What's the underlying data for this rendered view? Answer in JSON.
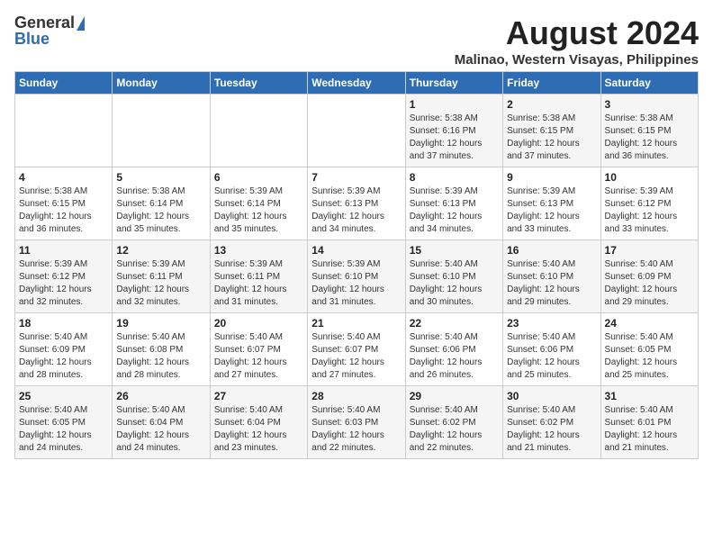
{
  "logo": {
    "general": "General",
    "blue": "Blue"
  },
  "title": "August 2024",
  "location": "Malinao, Western Visayas, Philippines",
  "days_of_week": [
    "Sunday",
    "Monday",
    "Tuesday",
    "Wednesday",
    "Thursday",
    "Friday",
    "Saturday"
  ],
  "weeks": [
    [
      {
        "day": "",
        "info": ""
      },
      {
        "day": "",
        "info": ""
      },
      {
        "day": "",
        "info": ""
      },
      {
        "day": "",
        "info": ""
      },
      {
        "day": "1",
        "info": "Sunrise: 5:38 AM\nSunset: 6:16 PM\nDaylight: 12 hours\nand 37 minutes."
      },
      {
        "day": "2",
        "info": "Sunrise: 5:38 AM\nSunset: 6:15 PM\nDaylight: 12 hours\nand 37 minutes."
      },
      {
        "day": "3",
        "info": "Sunrise: 5:38 AM\nSunset: 6:15 PM\nDaylight: 12 hours\nand 36 minutes."
      }
    ],
    [
      {
        "day": "4",
        "info": "Sunrise: 5:38 AM\nSunset: 6:15 PM\nDaylight: 12 hours\nand 36 minutes."
      },
      {
        "day": "5",
        "info": "Sunrise: 5:38 AM\nSunset: 6:14 PM\nDaylight: 12 hours\nand 35 minutes."
      },
      {
        "day": "6",
        "info": "Sunrise: 5:39 AM\nSunset: 6:14 PM\nDaylight: 12 hours\nand 35 minutes."
      },
      {
        "day": "7",
        "info": "Sunrise: 5:39 AM\nSunset: 6:13 PM\nDaylight: 12 hours\nand 34 minutes."
      },
      {
        "day": "8",
        "info": "Sunrise: 5:39 AM\nSunset: 6:13 PM\nDaylight: 12 hours\nand 34 minutes."
      },
      {
        "day": "9",
        "info": "Sunrise: 5:39 AM\nSunset: 6:13 PM\nDaylight: 12 hours\nand 33 minutes."
      },
      {
        "day": "10",
        "info": "Sunrise: 5:39 AM\nSunset: 6:12 PM\nDaylight: 12 hours\nand 33 minutes."
      }
    ],
    [
      {
        "day": "11",
        "info": "Sunrise: 5:39 AM\nSunset: 6:12 PM\nDaylight: 12 hours\nand 32 minutes."
      },
      {
        "day": "12",
        "info": "Sunrise: 5:39 AM\nSunset: 6:11 PM\nDaylight: 12 hours\nand 32 minutes."
      },
      {
        "day": "13",
        "info": "Sunrise: 5:39 AM\nSunset: 6:11 PM\nDaylight: 12 hours\nand 31 minutes."
      },
      {
        "day": "14",
        "info": "Sunrise: 5:39 AM\nSunset: 6:10 PM\nDaylight: 12 hours\nand 31 minutes."
      },
      {
        "day": "15",
        "info": "Sunrise: 5:40 AM\nSunset: 6:10 PM\nDaylight: 12 hours\nand 30 minutes."
      },
      {
        "day": "16",
        "info": "Sunrise: 5:40 AM\nSunset: 6:10 PM\nDaylight: 12 hours\nand 29 minutes."
      },
      {
        "day": "17",
        "info": "Sunrise: 5:40 AM\nSunset: 6:09 PM\nDaylight: 12 hours\nand 29 minutes."
      }
    ],
    [
      {
        "day": "18",
        "info": "Sunrise: 5:40 AM\nSunset: 6:09 PM\nDaylight: 12 hours\nand 28 minutes."
      },
      {
        "day": "19",
        "info": "Sunrise: 5:40 AM\nSunset: 6:08 PM\nDaylight: 12 hours\nand 28 minutes."
      },
      {
        "day": "20",
        "info": "Sunrise: 5:40 AM\nSunset: 6:07 PM\nDaylight: 12 hours\nand 27 minutes."
      },
      {
        "day": "21",
        "info": "Sunrise: 5:40 AM\nSunset: 6:07 PM\nDaylight: 12 hours\nand 27 minutes."
      },
      {
        "day": "22",
        "info": "Sunrise: 5:40 AM\nSunset: 6:06 PM\nDaylight: 12 hours\nand 26 minutes."
      },
      {
        "day": "23",
        "info": "Sunrise: 5:40 AM\nSunset: 6:06 PM\nDaylight: 12 hours\nand 25 minutes."
      },
      {
        "day": "24",
        "info": "Sunrise: 5:40 AM\nSunset: 6:05 PM\nDaylight: 12 hours\nand 25 minutes."
      }
    ],
    [
      {
        "day": "25",
        "info": "Sunrise: 5:40 AM\nSunset: 6:05 PM\nDaylight: 12 hours\nand 24 minutes."
      },
      {
        "day": "26",
        "info": "Sunrise: 5:40 AM\nSunset: 6:04 PM\nDaylight: 12 hours\nand 24 minutes."
      },
      {
        "day": "27",
        "info": "Sunrise: 5:40 AM\nSunset: 6:04 PM\nDaylight: 12 hours\nand 23 minutes."
      },
      {
        "day": "28",
        "info": "Sunrise: 5:40 AM\nSunset: 6:03 PM\nDaylight: 12 hours\nand 22 minutes."
      },
      {
        "day": "29",
        "info": "Sunrise: 5:40 AM\nSunset: 6:02 PM\nDaylight: 12 hours\nand 22 minutes."
      },
      {
        "day": "30",
        "info": "Sunrise: 5:40 AM\nSunset: 6:02 PM\nDaylight: 12 hours\nand 21 minutes."
      },
      {
        "day": "31",
        "info": "Sunrise: 5:40 AM\nSunset: 6:01 PM\nDaylight: 12 hours\nand 21 minutes."
      }
    ]
  ]
}
